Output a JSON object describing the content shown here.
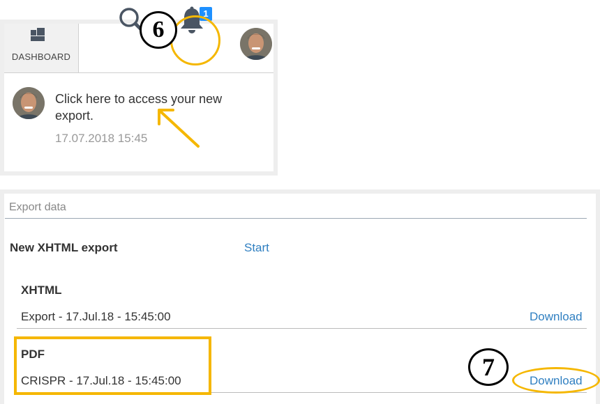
{
  "header": {
    "dashboard_label": "DASHBOARD",
    "notification_count": "1",
    "step_marker": "6"
  },
  "notification": {
    "message": "Click here to access your new export.",
    "timestamp": "17.07.2018 15:45"
  },
  "export": {
    "title": "Export data",
    "new_export_label": "New XHTML export",
    "start_label": "Start",
    "step_marker": "7",
    "items": [
      {
        "format": "XHTML",
        "description": "Export - 17.Jul.18 - 15:45:00",
        "action": "Download"
      },
      {
        "format": "PDF",
        "description": "CRISPR - 17.Jul.18 - 15:45:00",
        "action": "Download"
      }
    ]
  },
  "colors": {
    "highlight": "#f5b700",
    "link": "#2f7fc1",
    "badge": "#1e90ff"
  },
  "icons": [
    "dashboard-icon",
    "search-icon",
    "bell-icon",
    "avatar",
    "arrow-icon"
  ]
}
